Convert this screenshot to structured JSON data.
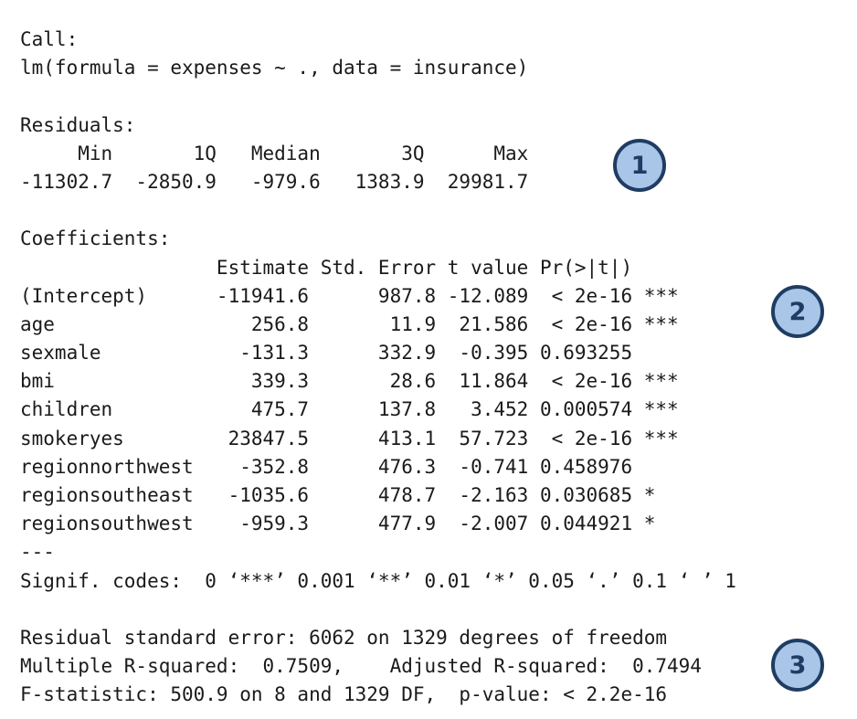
{
  "output": {
    "lines": [
      "Call:",
      "lm(formula = expenses ~ ., data = insurance)",
      "",
      "Residuals:",
      "     Min       1Q   Median       3Q      Max",
      "-11302.7  -2850.9   -979.6   1383.9  29981.7",
      "",
      "Coefficients:",
      "                 Estimate Std. Error t value Pr(>|t|)    ",
      "(Intercept)      -11941.6      987.8 -12.089  < 2e-16 ***",
      "age                 256.8       11.9  21.586  < 2e-16 ***",
      "sexmale            -131.3      332.9  -0.395 0.693255    ",
      "bmi                 339.3       28.6  11.864  < 2e-16 ***",
      "children            475.7      137.8   3.452 0.000574 ***",
      "smokeryes         23847.5      413.1  57.723  < 2e-16 ***",
      "regionnorthwest    -352.8      476.3  -0.741 0.458976    ",
      "regionsoutheast   -1035.6      478.7  -2.163 0.030685 *  ",
      "regionsouthwest    -959.3      477.9  -2.007 0.044921 *  ",
      "---",
      "Signif. codes:  0 ‘***’ 0.001 ‘**’ 0.01 ‘*’ 0.05 ‘.’ 0.1 ‘ ’ 1",
      "",
      "Residual standard error: 6062 on 1329 degrees of freedom",
      "Multiple R-squared:  0.7509,\tAdjusted R-squared:  0.7494 ",
      "F-statistic: 500.9 on 8 and 1329 DF,  p-value: < 2.2e-16"
    ]
  },
  "badges": {
    "residuals": "1",
    "coefficients": "2",
    "fit_statistics": "3"
  },
  "colors": {
    "badge_fill": "#a9c6e8",
    "badge_border": "#1f3d63",
    "text": "#1a1a1a"
  }
}
